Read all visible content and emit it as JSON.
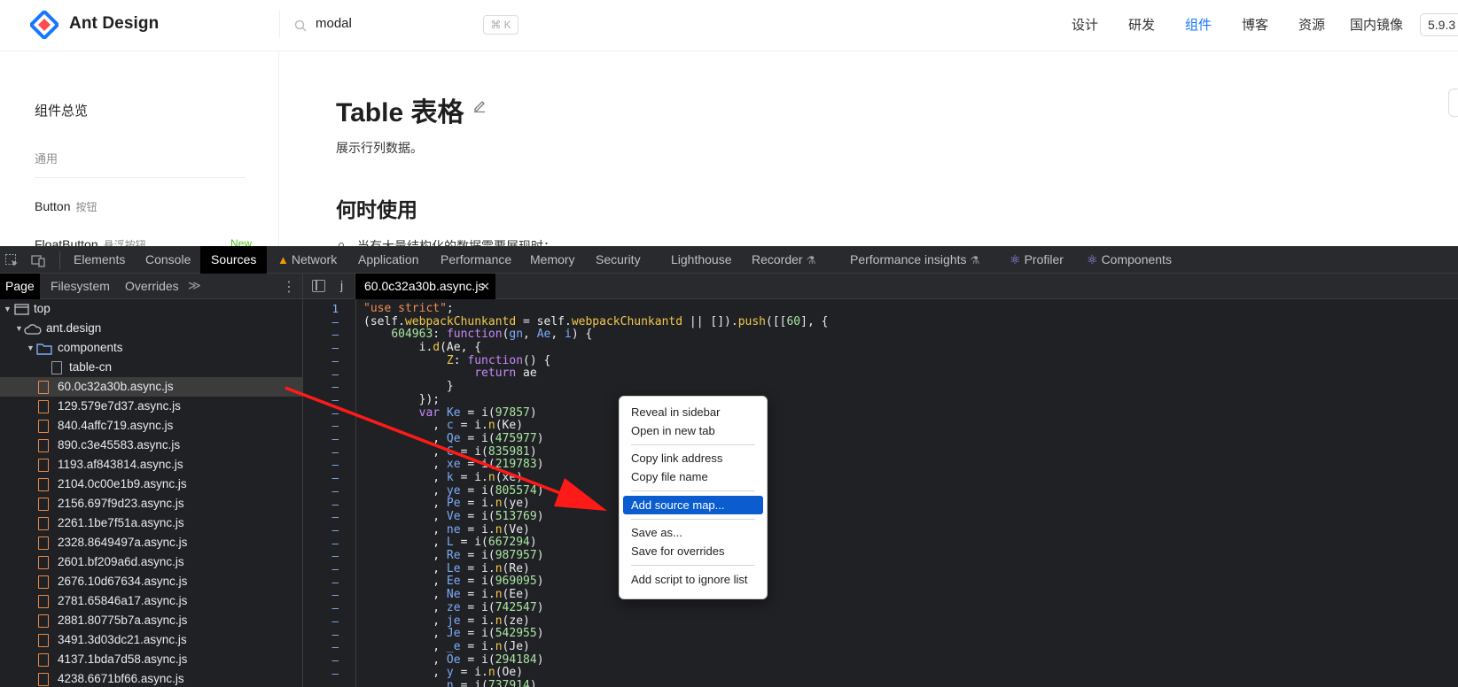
{
  "site": {
    "brand": "Ant Design",
    "search_value": "modal",
    "search_shortcut": "⌘ K",
    "nav": [
      "设计",
      "研发",
      "组件",
      "博客",
      "资源",
      "国内镜像"
    ],
    "version": "5.9.3",
    "sidebar": {
      "overview": "组件总览",
      "group": "通用",
      "item1_label": "Button",
      "item1_sub": "按钮",
      "item2_label": "FloatButton",
      "item2_sub": "悬浮按钮",
      "item2_tag": "New"
    },
    "content": {
      "title": "Table 表格",
      "description": "展示行列数据。",
      "when_heading": "何时使用",
      "bullet": "当有大量结构化的数据需要展现时；"
    },
    "accent": "#1677ff"
  },
  "devtools": {
    "tabs": [
      "Elements",
      "Console",
      "Sources",
      "Network",
      "Application",
      "Performance",
      "Memory",
      "Security",
      "Lighthouse",
      "Recorder",
      "Performance insights",
      "Profiler",
      "Components"
    ],
    "active_tab": "Sources",
    "navigator_tabs": [
      "Page",
      "Filesystem",
      "Overrides"
    ],
    "more_tabs": "≫",
    "tree": {
      "top": "top",
      "domain": "ant.design",
      "folder": "components",
      "doc": "table-cn",
      "files": [
        "60.0c32a30b.async.js",
        "129.579e7d37.async.js",
        "840.4affc719.async.js",
        "890.c3e45583.async.js",
        "1193.af843814.async.js",
        "2104.0c00e1b9.async.js",
        "2156.697f9d23.async.js",
        "2261.1be7f51a.async.js",
        "2328.8649497a.async.js",
        "2601.bf209a6d.async.js",
        "2676.10d67634.async.js",
        "2781.65846a17.async.js",
        "2881.80775b7a.async.js",
        "3491.3d03dc21.async.js",
        "4137.1bda7d58.async.js",
        "4238.6671bf66.async.js"
      ],
      "selected_file": "60.0c32a30b.async.js"
    },
    "editor": {
      "tab_j": "j",
      "open_file": "60.0c32a30b.async.js",
      "close": "✕",
      "line_numbers": [
        "1",
        "–",
        "–",
        "–",
        "–",
        "–",
        "–",
        "–",
        "–",
        "–",
        "–",
        "–",
        "–",
        "–",
        "–",
        "–",
        "–",
        "–",
        "–",
        "–",
        "–",
        "–",
        "–",
        "–",
        "–",
        "–",
        "–",
        "–",
        "–"
      ]
    },
    "context_menu": {
      "items": [
        "Reveal in sidebar",
        "Open in new tab",
        "Copy link address",
        "Copy file name",
        "Add source map...",
        "Save as...",
        "Save for overrides",
        "Add script to ignore list"
      ],
      "highlighted": "Add source map..."
    },
    "annotation_color": "#ff1a1a"
  }
}
